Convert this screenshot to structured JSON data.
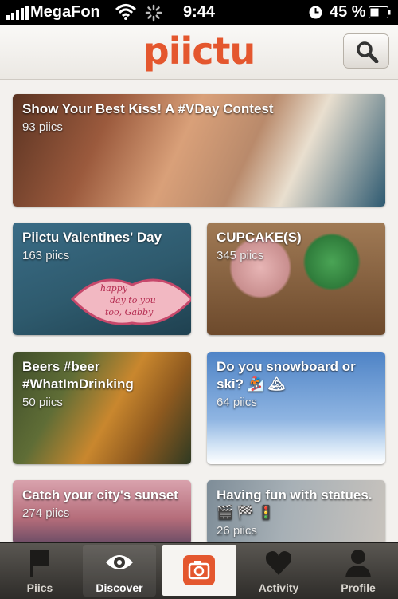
{
  "status_bar": {
    "carrier": "MegaFon",
    "time": "9:44",
    "battery": "45 %",
    "icons": [
      "signal-icon",
      "wifi-icon",
      "activity-spinner-icon",
      "clock-icon",
      "battery-icon"
    ]
  },
  "header": {
    "logo": "piictu",
    "search_icon": "search-icon"
  },
  "colors": {
    "brand": "#e4572e",
    "background": "#f3f1ee",
    "tabbar": "#3a3835"
  },
  "threads": [
    {
      "title": "Show Your Best Kiss! A #VDay Contest",
      "count": "93 piics"
    },
    {
      "title": "Piictu Valentines' Day",
      "count": "163 piics"
    },
    {
      "title": "CUPCAKE(S)",
      "count": "345 piics"
    },
    {
      "title": "Beers #beer #WhatImDrinking",
      "count": "50 piics"
    },
    {
      "title": "Do you snowboard or ski? 🏂 🏔",
      "count": "64 piics"
    },
    {
      "title": "Catch your city's sunset",
      "count": "274 piics"
    },
    {
      "title": "Having fun with statues. 🎬 🏁 🚦",
      "count": "26 piics"
    }
  ],
  "card_image_text": {
    "line1": "happy",
    "line2": "day to you",
    "line3": "too, Gabby"
  },
  "tabs": [
    {
      "label": "Piics",
      "icon": "piics-flag-icon"
    },
    {
      "label": "Discover",
      "icon": "eye-icon"
    },
    {
      "label": "",
      "icon": "camera-icon"
    },
    {
      "label": "Activity",
      "icon": "heart-icon"
    },
    {
      "label": "Profile",
      "icon": "person-icon"
    }
  ]
}
